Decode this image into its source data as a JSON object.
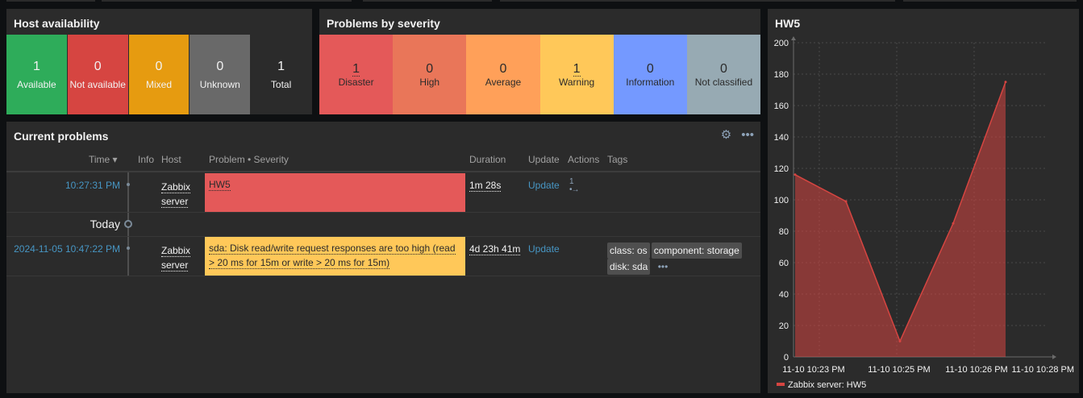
{
  "host_availability": {
    "title": "Host availability",
    "cells": [
      {
        "count": "1",
        "label": "Available",
        "color": "#2eac5a"
      },
      {
        "count": "0",
        "label": "Not available",
        "color": "#d64541"
      },
      {
        "count": "0",
        "label": "Mixed",
        "color": "#e69b10"
      },
      {
        "count": "0",
        "label": "Unknown",
        "color": "#696969"
      },
      {
        "count": "1",
        "label": "Total",
        "color": "#2b2b2b"
      }
    ]
  },
  "problems_by_severity": {
    "title": "Problems by severity",
    "cells": [
      {
        "count": "1",
        "label": "Disaster",
        "color": "#e45959"
      },
      {
        "count": "0",
        "label": "High",
        "color": "#e97659"
      },
      {
        "count": "0",
        "label": "Average",
        "color": "#ffa059"
      },
      {
        "count": "1",
        "label": "Warning",
        "color": "#ffc859"
      },
      {
        "count": "0",
        "label": "Information",
        "color": "#7499ff"
      },
      {
        "count": "0",
        "label": "Not classified",
        "color": "#97aab3"
      }
    ]
  },
  "current_problems": {
    "title": "Current problems",
    "icons": [
      "gear-icon",
      "more-icon"
    ],
    "columns": {
      "time": "Time ▾",
      "info": "Info",
      "host": "Host",
      "problem": "Problem • Severity",
      "duration": "Duration",
      "update": "Update",
      "actions": "Actions",
      "tags": "Tags"
    },
    "rows": [
      {
        "time": "10:27:31 PM",
        "host_line1": "Zabbix",
        "host_line2": "server",
        "problem": "HW5",
        "severity_color": "#e45959",
        "duration": "1m 28s",
        "update": "Update",
        "actions_count": "1",
        "tags": []
      },
      {
        "time": "2024-11-05 10:47:22 PM",
        "host_line1": "Zabbix",
        "host_line2": "server",
        "problem": "sda: Disk read/write request responses are too high (read > 20 ms for 15m or write > 20 ms for 15m)",
        "severity_color": "#ffc859",
        "duration": "4d 23h 41m",
        "update": "Update",
        "actions_count": "",
        "tags": [
          "class: os",
          "component: storage",
          "disk: sda"
        ]
      }
    ],
    "today_label": "Today",
    "more_tags": "•••"
  },
  "graph": {
    "title": "HW5",
    "legend": "Zabbix server: HW5",
    "series_color": "#d64541"
  },
  "chart_data": {
    "type": "area",
    "title": "HW5",
    "x": [
      "10:22:42 PM",
      "10:24:00 PM",
      "10:24:52 PM",
      "10:25:40 PM",
      "10:26:25 PM"
    ],
    "series": [
      {
        "name": "Zabbix server: HW5",
        "values": [
          116,
          99,
          10,
          85,
          175
        ]
      }
    ],
    "x_ticks": [
      "11-10 10:23 PM",
      "11-10 10:25 PM",
      "11-10 10:26 PM",
      "11-10 10:28 PM"
    ],
    "y_ticks": [
      0,
      20,
      40,
      60,
      80,
      100,
      120,
      140,
      160,
      180,
      200
    ],
    "ylim": [
      0,
      200
    ],
    "grid": true,
    "legend_position": "bottom-left"
  }
}
